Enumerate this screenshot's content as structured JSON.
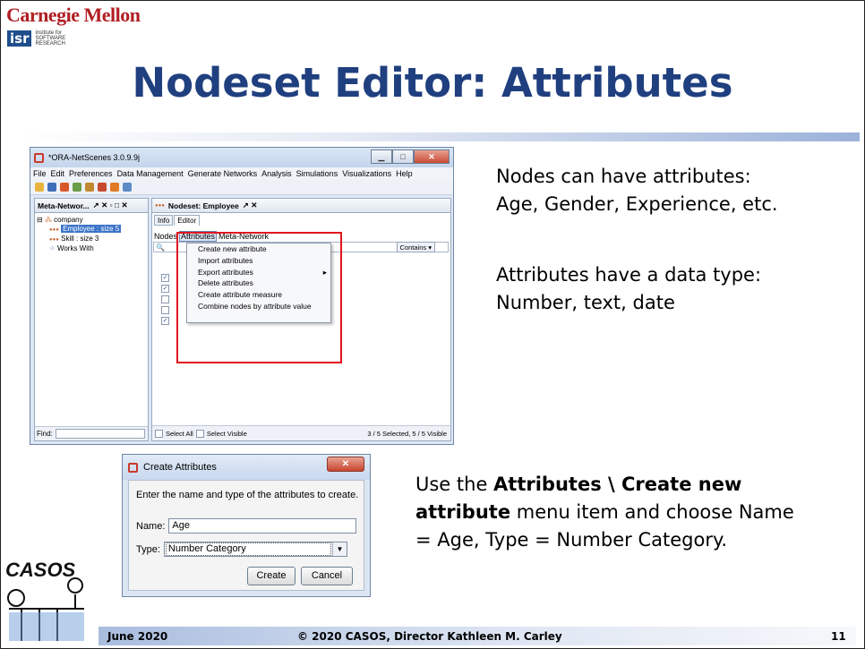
{
  "logo": {
    "cmu": "Carnegie Mellon",
    "isr_mark": "isr",
    "isr_line1": "institute for",
    "isr_line2": "SOFTWARE",
    "isr_line3": "RESEARCH"
  },
  "slide": {
    "title": "Nodeset Editor: Attributes",
    "page_number": "11"
  },
  "right_text": {
    "p1_line1": "Nodes can have attributes:",
    "p1_line2": "Age, Gender, Experience, etc.",
    "p2_line1": "Attributes have a data type:",
    "p2_line2": "Number, text, date",
    "p3_pre": "Use the ",
    "p3_bold": "Attributes \\ Create new attribute",
    "p3_post": " menu item and choose Name = Age, Type = Number Category."
  },
  "app": {
    "title": "*ORA-NetScenes 3.0.9.9j",
    "menu": [
      "File",
      "Edit",
      "Preferences",
      "Data Management",
      "Generate Networks",
      "Analysis",
      "Simulations",
      "Visualizations",
      "Help"
    ],
    "left_tab": "Meta-Networ...",
    "tree": {
      "root": "company",
      "n1": "Employee : size 5",
      "n2": "Skill : size 3",
      "n3": "Works With"
    },
    "find_label": "Find:",
    "right_tab": "Nodeset: Employee",
    "subtabs": [
      "Info",
      "Editor"
    ],
    "inner_menu": [
      "Nodes",
      "Attributes",
      "Meta-Network"
    ],
    "contains": "Contains",
    "dropdown": [
      "Create new attribute",
      "Import attributes",
      "Export attributes",
      "Delete attributes",
      "Create attribute measure",
      "Combine nodes by attribute value"
    ],
    "select_all": "Select All",
    "select_visible": "Select Visible",
    "status": "3 / 5 Selected, 5 / 5 Visible"
  },
  "dialog": {
    "title": "Create Attributes",
    "prompt": "Enter the name and type of the attributes to create.",
    "name_label": "Name:",
    "name_value": "Age",
    "type_label": "Type:",
    "type_value": "Number Category",
    "create": "Create",
    "cancel": "Cancel"
  },
  "footer": {
    "date": "June 2020",
    "copyright": "© 2020 CASOS, Director Kathleen M. Carley",
    "casos": "CASOS"
  },
  "colors": {
    "title": "#1f3f7f",
    "cmu_red": "#b11f24",
    "highlight_red": "#e0141f",
    "selection": "#3c74c9"
  }
}
